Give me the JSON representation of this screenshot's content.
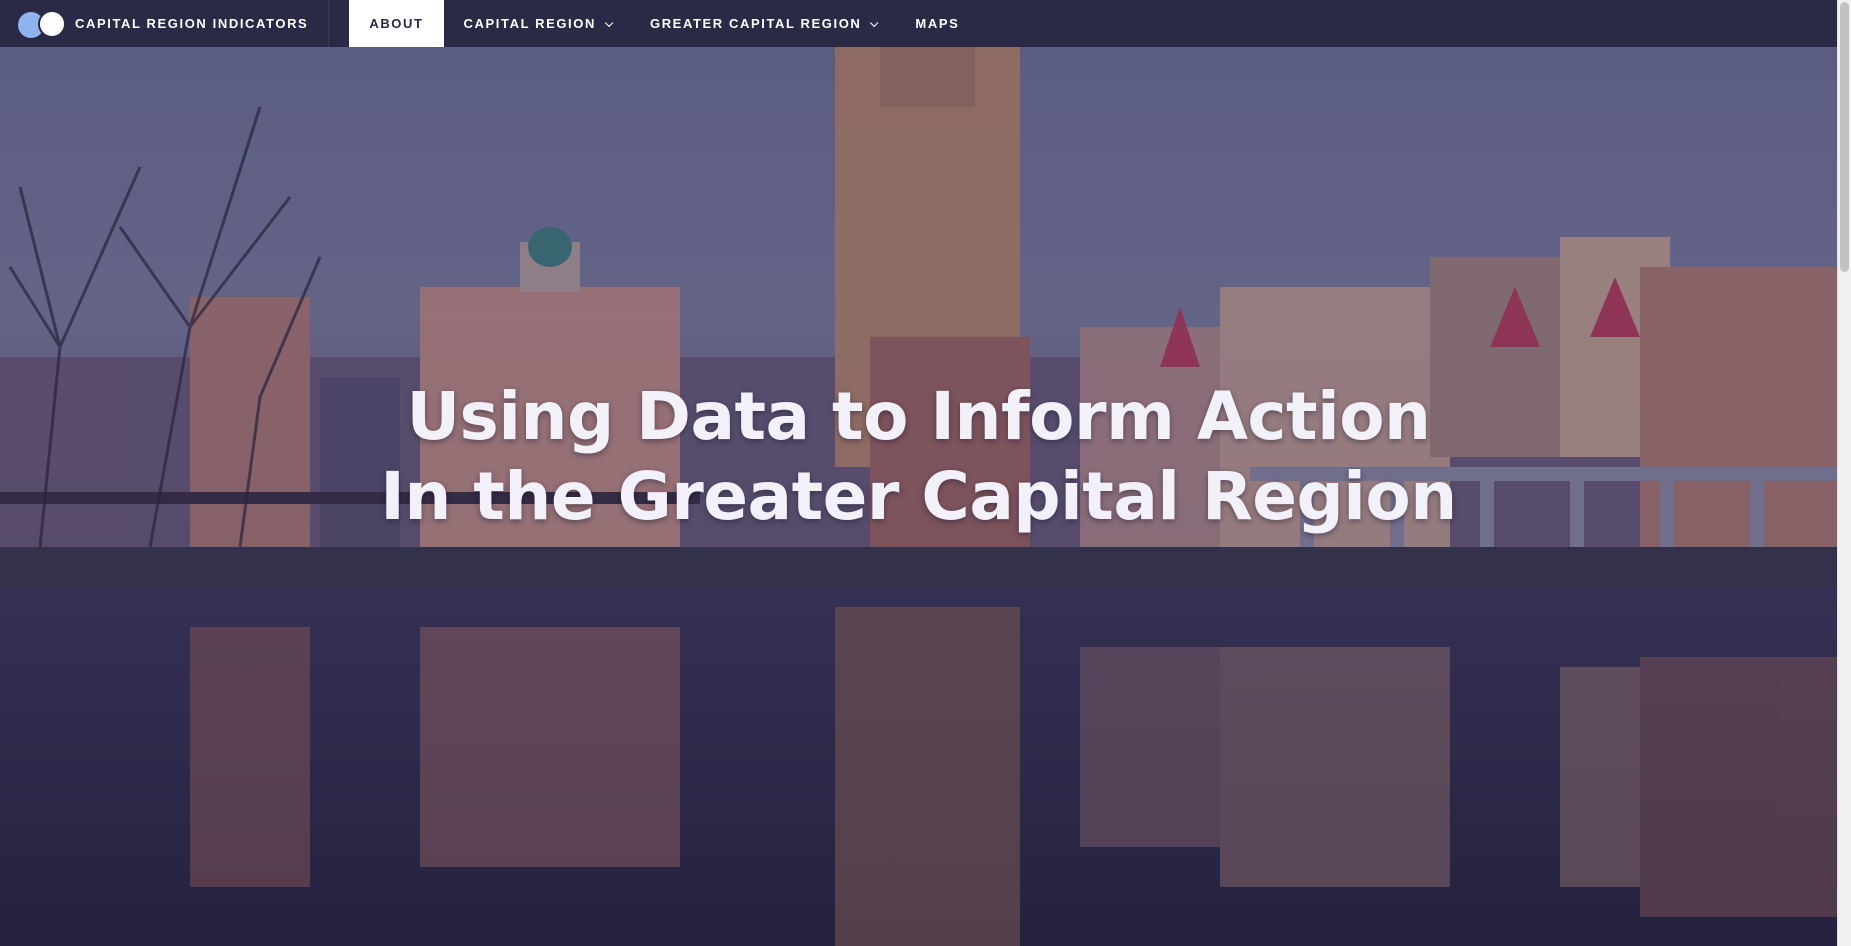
{
  "brand": {
    "name": "CAPITAL REGION INDICATORS",
    "logo_colors": [
      "#8fb4f0",
      "#ffffff"
    ]
  },
  "nav": {
    "items": [
      {
        "label": "ABOUT",
        "active": true,
        "dropdown": false
      },
      {
        "label": "CAPITAL REGION",
        "active": false,
        "dropdown": true
      },
      {
        "label": "GREATER CAPITAL REGION",
        "active": false,
        "dropdown": true
      },
      {
        "label": "MAPS",
        "active": false,
        "dropdown": false
      }
    ]
  },
  "hero": {
    "title_line1": "Using Data to Inform Action",
    "title_line2": "In the Greater Capital Region"
  },
  "colors": {
    "navbar": "#2b2a46",
    "hero_overlay": "#28265a",
    "text": "#ffffff"
  }
}
